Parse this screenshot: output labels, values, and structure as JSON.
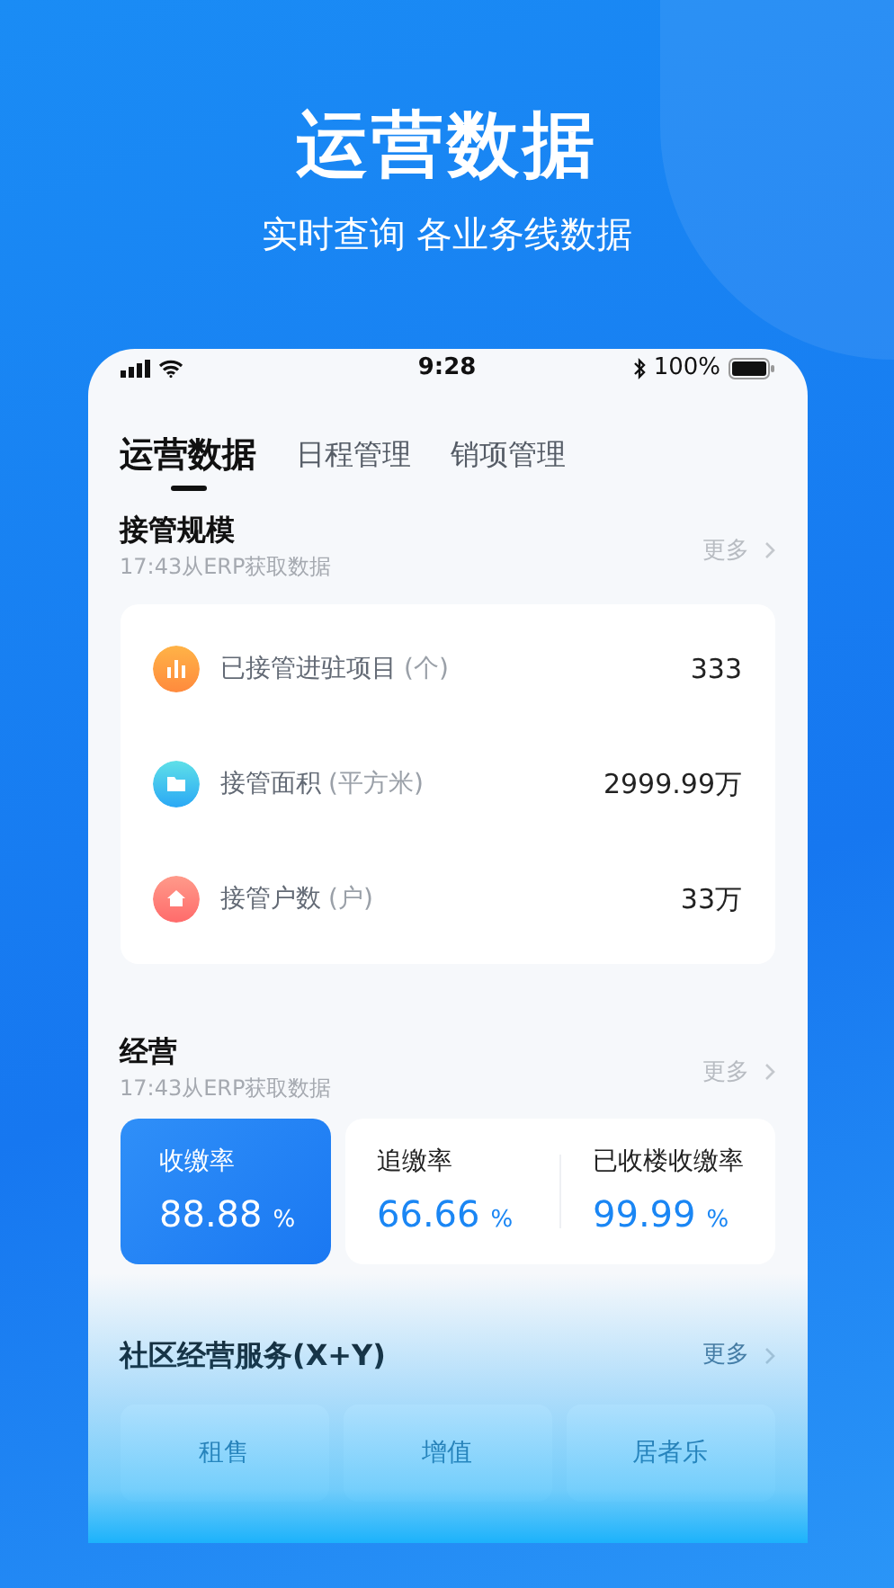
{
  "headline": "运营数据",
  "subheadline": "实时查询 各业务线数据",
  "status_bar": {
    "time": "9:28",
    "battery": "100%"
  },
  "tabs": [
    {
      "label": "运营数据",
      "selected": true
    },
    {
      "label": "日程管理",
      "selected": false
    },
    {
      "label": "销项管理",
      "selected": false
    }
  ],
  "scale_section": {
    "title": "接管规模",
    "subtitle": "17:43从ERP获取数据",
    "more": "更多",
    "items": [
      {
        "kind": "chart",
        "label": "已接管进驻项目",
        "unit": "(个)",
        "value": "333"
      },
      {
        "kind": "folder",
        "label": "接管面积",
        "unit": "(平方米)",
        "value": "2999.99万"
      },
      {
        "kind": "home",
        "label": "接管户数",
        "unit": "(户)",
        "value": "33万"
      }
    ]
  },
  "operation_section": {
    "title": "经营",
    "subtitle": "17:43从ERP获取数据",
    "more": "更多",
    "rates": [
      {
        "label": "收缴率",
        "value": "88.88",
        "unit": "%",
        "selected": true
      },
      {
        "label": "追缴率",
        "value": "66.66",
        "unit": "%",
        "selected": false
      },
      {
        "label": "已收楼收缴率",
        "value": "99.99",
        "unit": "%",
        "selected": false
      }
    ]
  },
  "service_section": {
    "title": "社区经营服务(X+Y)",
    "more": "更多",
    "items": [
      "租售",
      "增值",
      "居者乐"
    ]
  }
}
